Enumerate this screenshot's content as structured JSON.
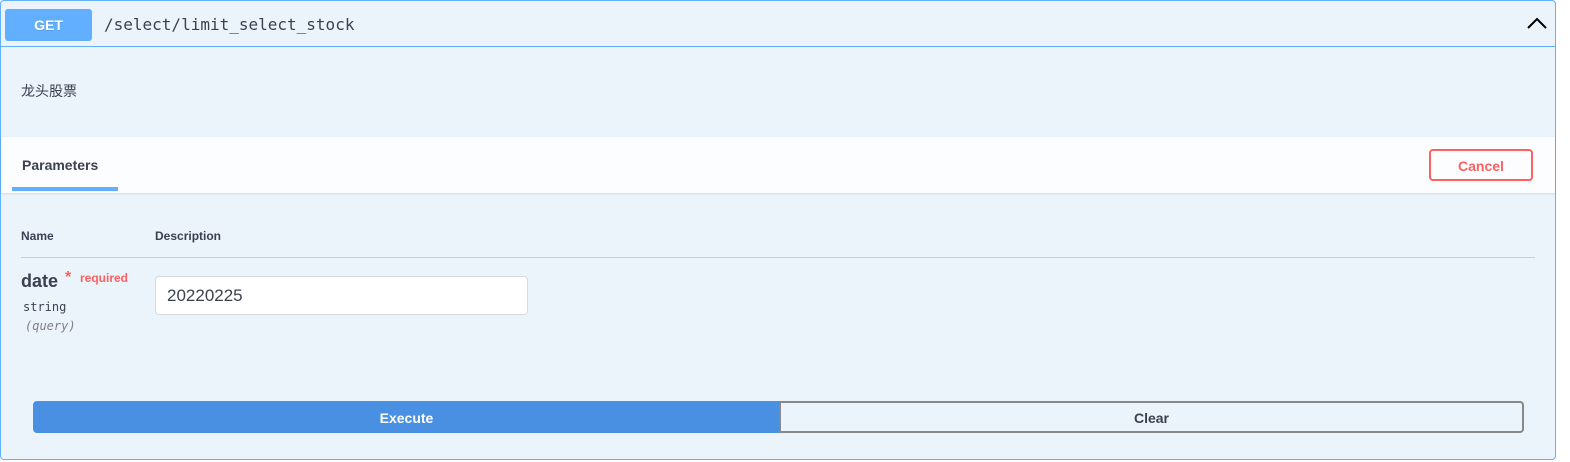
{
  "operation": {
    "method": "GET",
    "path": "/select/limit_select_stock",
    "description": "龙头股票",
    "collapse_icon": "chevron-up-icon"
  },
  "parameters_section": {
    "tab_label": "Parameters",
    "cancel_label": "Cancel",
    "columns": {
      "name": "Name",
      "description": "Description"
    },
    "params": [
      {
        "name": "date",
        "required_star": "*",
        "required_label": "required",
        "type": "string",
        "in": "(query)",
        "value": "20220225"
      }
    ]
  },
  "actions": {
    "execute_label": "Execute",
    "clear_label": "Clear"
  },
  "colors": {
    "method_get": "#61affe",
    "background": "#ebf3fb",
    "danger": "#ff6060",
    "execute": "#4990e2",
    "text": "#3b4151"
  }
}
